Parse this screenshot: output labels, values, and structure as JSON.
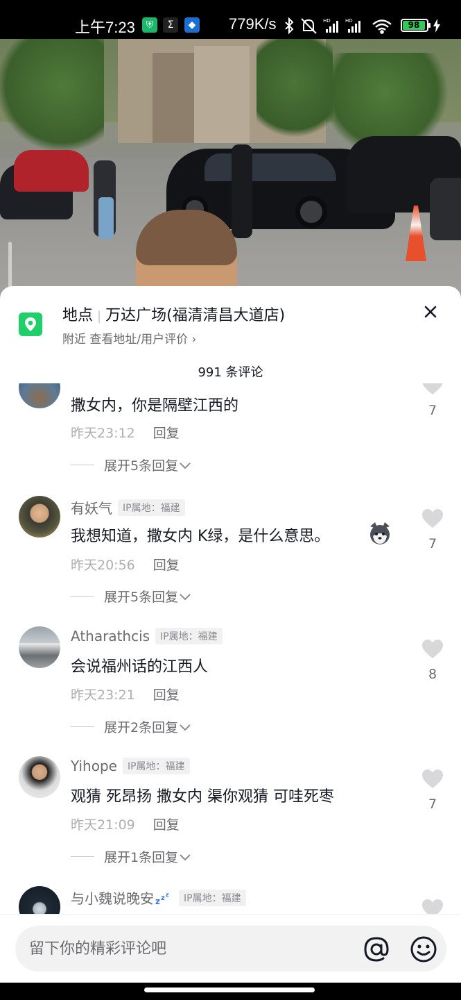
{
  "status_bar": {
    "time": "上午7:23",
    "network_speed": "779K/s",
    "battery": "98",
    "icons": [
      "shield-app-icon",
      "sigma-app-icon",
      "blue-app-icon",
      "bluetooth-icon",
      "mute-icon",
      "signal-hd-icon",
      "signal-hd-icon",
      "wifi-icon",
      "battery-icon",
      "charging-icon"
    ]
  },
  "location": {
    "label": "地点",
    "name": "万达广场(福清清昌大道店)",
    "subtitle": "附近  查看地址/用户评价 ›",
    "icon": "map-pin-icon"
  },
  "comment_count": "991 条评论",
  "comments": [
    {
      "user": "",
      "ip": "",
      "text": "撒女内，你是隔壁江西的",
      "time": "昨天23:12",
      "reply": "回复",
      "expand": "展开5条回复",
      "likes": "7"
    },
    {
      "user": "有妖气",
      "ip": "IP属地：福建",
      "text": "我想知道，撒女内 K绿，是什么意思。",
      "time": "昨天20:56",
      "reply": "回复",
      "expand": "展开5条回复",
      "likes": "7"
    },
    {
      "user": "Atharathcis",
      "ip": "IP属地：福建",
      "text": "会说福州话的江西人",
      "time": "昨天23:21",
      "reply": "回复",
      "expand": "展开2条回复",
      "likes": "8"
    },
    {
      "user": "Yihope",
      "ip": "IP属地：福建",
      "text": "观猜 死昂扬 撒女内 渠你观猜  可哇死枣",
      "time": "昨天21:09",
      "reply": "回复",
      "expand": "展开1条回复",
      "likes": "7"
    },
    {
      "user": "与小魏说晚安",
      "ip": "IP属地：福建",
      "text": "",
      "time": "",
      "reply": "",
      "expand": "",
      "likes": ""
    }
  ],
  "input": {
    "placeholder": "留下你的精彩评论吧"
  },
  "colors": {
    "accent_green": "#1fcf6a",
    "text_primary": "#161823",
    "text_secondary": "#6b6b70",
    "text_muted": "#aeaeb3"
  }
}
